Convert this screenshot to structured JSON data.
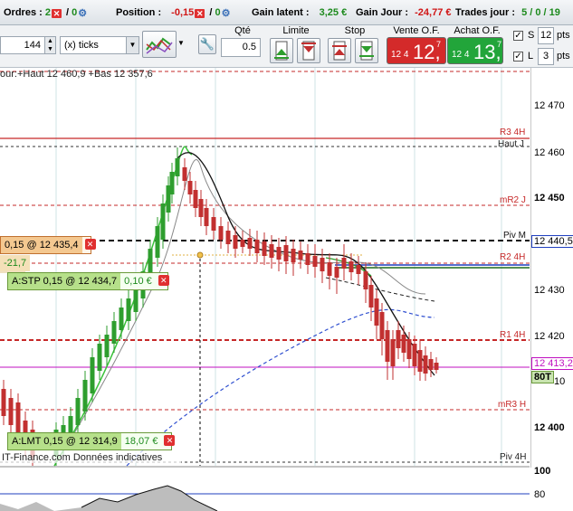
{
  "status": {
    "orders_label": "Ordres :",
    "orders_a": "2",
    "orders_b": "0",
    "position_label": "Position :",
    "position_value": "-0,15",
    "position_b": "0",
    "gain_latent_label": "Gain latent :",
    "gain_latent_value": "3,25 €",
    "gain_jour_label": "Gain Jour :",
    "gain_jour_value": "-24,77 €",
    "trades_label": "Trades jour :",
    "trades_value": "5 / 0 / 19"
  },
  "toolbar": {
    "ticks_value": "144",
    "ticks_unit": "(x) ticks",
    "qty_label": "Qté",
    "qty_value": "0.5",
    "limit_label": "Limite",
    "stop_label": "Stop",
    "sell_label": "Vente O.F.",
    "sell_small": "12 4",
    "sell_big": "12,",
    "sell_sup": "7",
    "buy_label": "Achat O.F.",
    "buy_small": "12 4",
    "buy_big": "13,",
    "buy_sup": "7",
    "s_label": "S",
    "s_value": "12",
    "s_unit": "pts",
    "l_label": "L",
    "l_value": "3",
    "l_unit": "pts"
  },
  "chart": {
    "info_line": "our:+Haut 12 460,9 +Bas 12 357,6",
    "footer_text": "IT-Finance.com  Données indicatives",
    "price_axis": [
      "12 470",
      "12 460",
      "12 450",
      "12 440",
      "12 430",
      "12 420",
      "12 410",
      "12 400"
    ],
    "current_price": "12 440,5",
    "last_price": "12 413,2",
    "volume_tag": "80T",
    "indicator_axis": [
      "100",
      "80"
    ],
    "levels": {
      "r3": "R3 4H",
      "haut": "Haut J",
      "mr2": "mR2 J",
      "piv_m": "Piv M",
      "r2": "R2 4H",
      "r1": "R1 4H",
      "mr3": "mR3 H",
      "piv4": "Piv 4H"
    },
    "orders": [
      {
        "tag": "0,15 @ 12 435,4",
        "pnl": ""
      },
      {
        "tag": "-21,7",
        "pnl": ""
      },
      {
        "tag": "A:STP  0,15 @ 12 434,7",
        "pnl": "0,10 €"
      },
      {
        "tag": "A:LMT  0,15 @ 12 314,9",
        "pnl": "18,07 €"
      }
    ],
    "colors": {
      "bull": "#2e9e2e",
      "bear": "#c23030",
      "resistance": "#c62828",
      "pivot": "#111111",
      "blue_line": "#1f3fbf",
      "magenta": "#c010c0"
    }
  }
}
